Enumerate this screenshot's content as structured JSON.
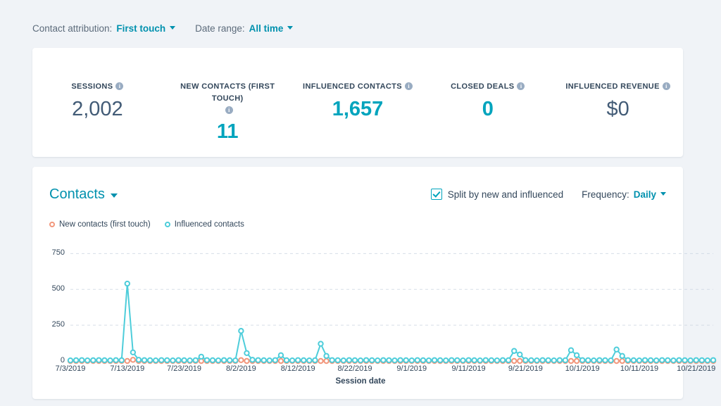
{
  "filters": {
    "attribution_label": "Contact attribution:",
    "attribution_value": "First touch",
    "daterange_label": "Date range:",
    "daterange_value": "All time"
  },
  "kpis": [
    {
      "label": "SESSIONS",
      "value": "2,002",
      "style": "gray",
      "info": "i"
    },
    {
      "label": "NEW CONTACTS (FIRST TOUCH)",
      "value": "11",
      "style": "teal",
      "info": "i"
    },
    {
      "label": "INFLUENCED CONTACTS",
      "value": "1,657",
      "style": "teal",
      "info": "i"
    },
    {
      "label": "CLOSED DEALS",
      "value": "0",
      "style": "teal",
      "info": "i"
    },
    {
      "label": "INFLUENCED REVENUE",
      "value": "$0",
      "style": "gray",
      "info": "i"
    }
  ],
  "chart_header": {
    "title": "Contacts",
    "split_checkbox_label": "Split by new and influenced",
    "split_checked": true,
    "frequency_label": "Frequency:",
    "frequency_value": "Daily"
  },
  "colors": {
    "teal": "#4ecdda",
    "salmon": "#f2977c",
    "link": "#0091ae",
    "text": "#33475b",
    "page_bg": "#f0f3f7",
    "card_bg": "#ffffff",
    "grid": "#cbd6e2"
  },
  "chart_data": {
    "type": "line",
    "title": "Contacts",
    "xlabel": "Session date",
    "ylabel": "",
    "ylim": [
      0,
      850
    ],
    "yticks": [
      0,
      250,
      500,
      750
    ],
    "grid": true,
    "legend_position": "top-left",
    "markers": "open-circle",
    "x_start": "7/3/2019",
    "x_end": "10/24/2019",
    "xtick_labels": [
      "7/3/2019",
      "7/13/2019",
      "7/23/2019",
      "8/2/2019",
      "8/12/2019",
      "8/22/2019",
      "9/1/2019",
      "9/11/2019",
      "9/21/2019",
      "10/1/2019",
      "10/11/2019",
      "10/21/2019"
    ],
    "xtick_indices": [
      0,
      10,
      20,
      30,
      40,
      50,
      60,
      70,
      80,
      90,
      100,
      110
    ],
    "series": [
      {
        "name": "New contacts (first touch)",
        "color": "#f2977c",
        "values": [
          0,
          0,
          0,
          0,
          0,
          0,
          0,
          0,
          0,
          0,
          0,
          8,
          0,
          0,
          0,
          0,
          0,
          0,
          0,
          0,
          0,
          0,
          0,
          0,
          0,
          0,
          0,
          0,
          0,
          0,
          6,
          0,
          0,
          0,
          0,
          0,
          0,
          0,
          0,
          0,
          0,
          0,
          0,
          0,
          0,
          0,
          0,
          0,
          0,
          0,
          0,
          0,
          0,
          0,
          0,
          0,
          0,
          0,
          0,
          0,
          0,
          0,
          0,
          0,
          0,
          0,
          0,
          0,
          0,
          0,
          0,
          0,
          0,
          0,
          0,
          0,
          0,
          0,
          0,
          0,
          0,
          0,
          0,
          0,
          0,
          0,
          0,
          0,
          0,
          0,
          0,
          0,
          0,
          0,
          0,
          0,
          0,
          0,
          0,
          0,
          0,
          0,
          0,
          0,
          0,
          0,
          0,
          0,
          0,
          0,
          0,
          0,
          0,
          0
        ]
      },
      {
        "name": "Influenced contacts",
        "color": "#4ecdda",
        "values": [
          4,
          5,
          6,
          4,
          5,
          6,
          5,
          4,
          6,
          5,
          540,
          60,
          8,
          6,
          5,
          4,
          6,
          5,
          4,
          6,
          5,
          4,
          5,
          30,
          6,
          5,
          4,
          6,
          5,
          4,
          210,
          55,
          8,
          6,
          5,
          4,
          6,
          40,
          5,
          4,
          6,
          5,
          4,
          5,
          120,
          35,
          6,
          5,
          4,
          6,
          5,
          4,
          6,
          5,
          4,
          6,
          5,
          4,
          6,
          5,
          4,
          6,
          5,
          4,
          6,
          5,
          4,
          6,
          5,
          4,
          6,
          5,
          4,
          6,
          5,
          4,
          6,
          5,
          70,
          45,
          6,
          5,
          4,
          6,
          5,
          4,
          6,
          5,
          75,
          40,
          6,
          5,
          4,
          6,
          5,
          4,
          80,
          35,
          6,
          5,
          4,
          6,
          5,
          4,
          6,
          5,
          4,
          6,
          5,
          4,
          6,
          5,
          4,
          6
        ]
      }
    ]
  }
}
